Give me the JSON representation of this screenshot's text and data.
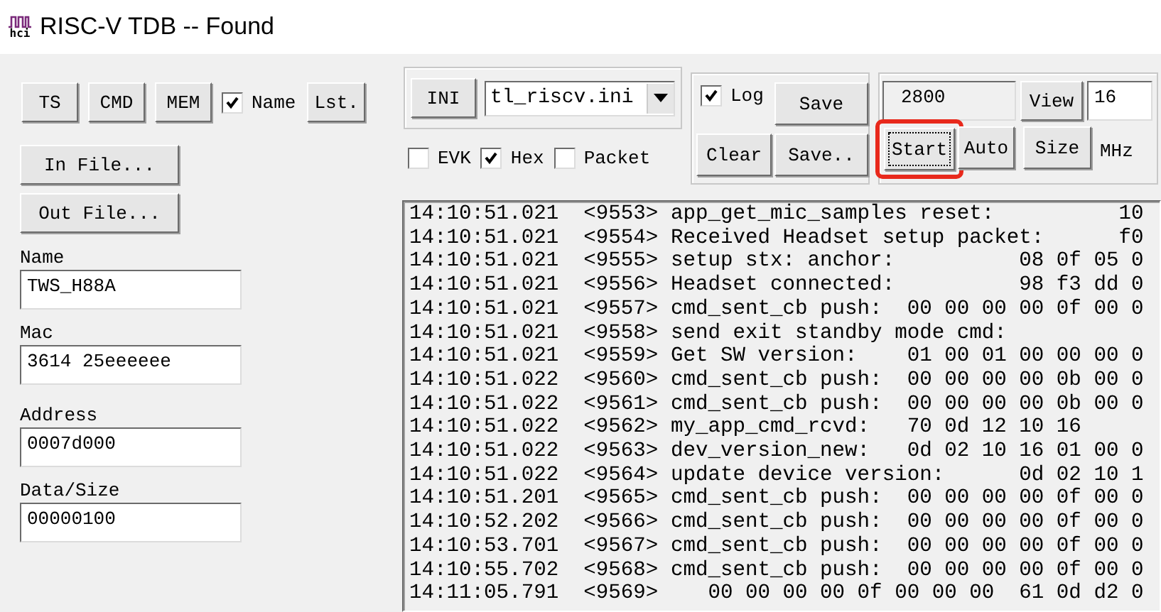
{
  "window": {
    "title": "RISC-V TDB -- Found",
    "logo_text": "hci"
  },
  "left": {
    "buttons": [
      "TS",
      "CMD",
      "MEM"
    ],
    "name_check": {
      "label": "Name",
      "checked": true
    },
    "list_button": "Lst.",
    "file_buttons": [
      "In File...",
      "Out File..."
    ],
    "fields": [
      {
        "label": "Name",
        "value": "TWS_H88A"
      },
      {
        "label": "Mac",
        "value": "3614 25eeeeee"
      },
      {
        "label": "Address",
        "value": "0007d000"
      },
      {
        "label": "Data/Size",
        "value": "00000100"
      }
    ]
  },
  "config": {
    "ini_button": "INI",
    "ini_file": "tl_riscv.ini",
    "options": [
      {
        "label": "EVK",
        "checked": false
      },
      {
        "label": "Hex",
        "checked": true
      },
      {
        "label": "Packet",
        "checked": false
      }
    ]
  },
  "log_controls": {
    "log_check": {
      "label": "Log",
      "checked": true
    },
    "save_button": "Save",
    "clear_button": "Clear",
    "save_as_button": "Save.."
  },
  "capture": {
    "count": "2800",
    "view_button": "View",
    "view_value": "16",
    "start_button": {
      "label": "Start",
      "highlighted": true
    },
    "auto_button": "Auto",
    "size_button": "Size",
    "unit": "MHz"
  },
  "log": {
    "lines": [
      {
        "time": "14:10:51.021",
        "seq": "<9553>",
        "text": "app_get_mic_samples reset:          10"
      },
      {
        "time": "14:10:51.021",
        "seq": "<9554>",
        "text": "Received Headset setup packet:      f0"
      },
      {
        "time": "14:10:51.021",
        "seq": "<9555>",
        "text": "setup stx: anchor:          08 0f 05 0"
      },
      {
        "time": "14:10:51.021",
        "seq": "<9556>",
        "text": "Headset connected:          98 f3 dd 0"
      },
      {
        "time": "14:10:51.021",
        "seq": "<9557>",
        "text": "cmd_sent_cb push:  00 00 00 00 0f 00 0"
      },
      {
        "time": "14:10:51.021",
        "seq": "<9558>",
        "text": "send exit standby mode cmd:"
      },
      {
        "time": "14:10:51.021",
        "seq": "<9559>",
        "text": "Get SW version:    01 00 01 00 00 00 0"
      },
      {
        "time": "14:10:51.022",
        "seq": "<9560>",
        "text": "cmd_sent_cb push:  00 00 00 00 0b 00 0"
      },
      {
        "time": "14:10:51.022",
        "seq": "<9561>",
        "text": "cmd_sent_cb push:  00 00 00 00 0b 00 0"
      },
      {
        "time": "14:10:51.022",
        "seq": "<9562>",
        "text": "my_app_cmd_rcvd:   70 0d 12 10 16"
      },
      {
        "time": "14:10:51.022",
        "seq": "<9563>",
        "text": "dev_version_new:   0d 02 10 16 01 00 0"
      },
      {
        "time": "14:10:51.022",
        "seq": "<9564>",
        "text": "update device version:      0d 02 10 1"
      },
      {
        "time": "14:10:51.201",
        "seq": "<9565>",
        "text": "cmd_sent_cb push:  00 00 00 00 0f 00 0"
      },
      {
        "time": "14:10:52.202",
        "seq": "<9566>",
        "text": "cmd_sent_cb push:  00 00 00 00 0f 00 0"
      },
      {
        "time": "14:10:53.701",
        "seq": "<9567>",
        "text": "cmd_sent_cb push:  00 00 00 00 0f 00 0"
      },
      {
        "time": "14:10:55.702",
        "seq": "<9568>",
        "text": "cmd_sent_cb push:  00 00 00 00 0f 00 0"
      },
      {
        "time": "14:11:05.791",
        "seq": "<9569>",
        "text": "   00 00 00 00 0f 00 00 00  61 0d d2 0"
      }
    ]
  }
}
